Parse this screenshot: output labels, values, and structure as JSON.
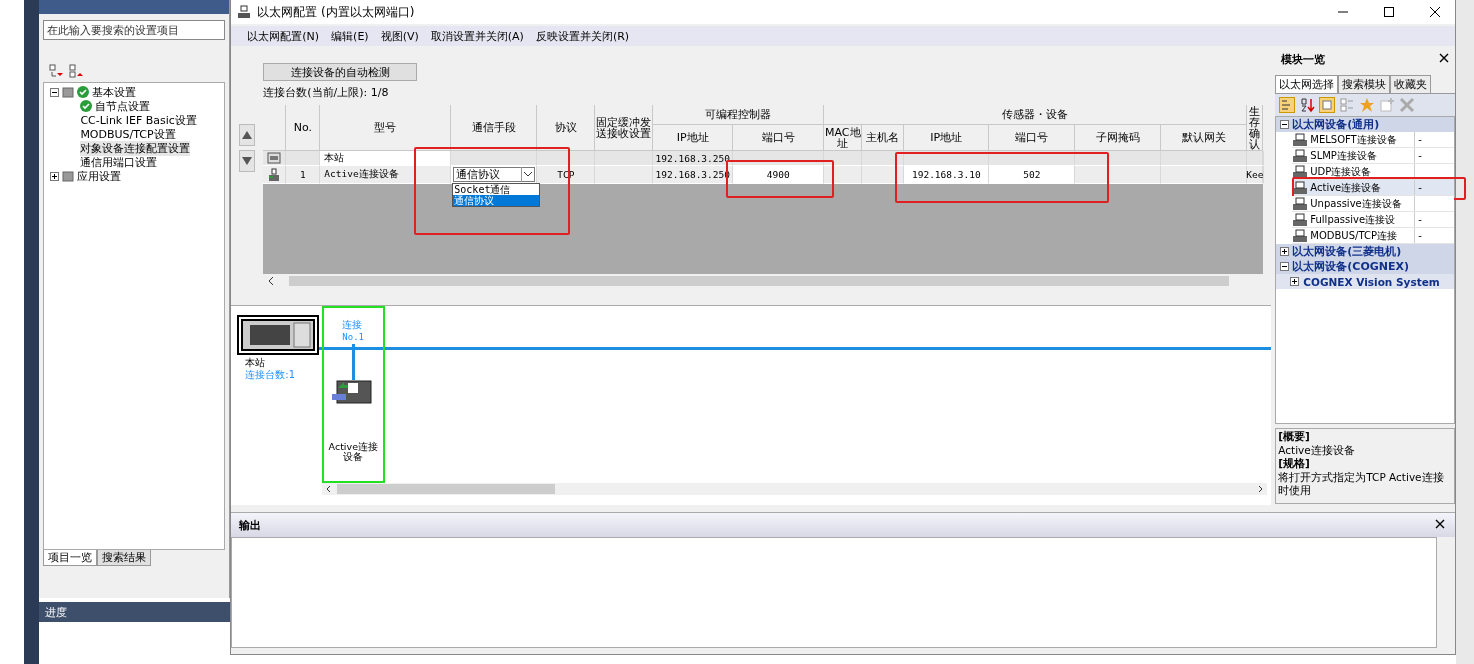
{
  "left_panel": {
    "search": {
      "placeholder": "在此输入要搜索的设置项目"
    },
    "tree": [
      {
        "label": "基本设置",
        "expanded": true,
        "done": true,
        "selected": false,
        "children": [
          {
            "label": "自节点设置",
            "done": true,
            "selected": false
          },
          {
            "label": "CC-Link IEF Basic设置",
            "done": false,
            "selected": false
          },
          {
            "label": "MODBUS/TCP设置",
            "done": false,
            "selected": false
          },
          {
            "label": "对象设备连接配置设置",
            "done": false,
            "selected": true
          },
          {
            "label": "通信用端口设置",
            "done": false,
            "selected": false
          }
        ]
      },
      {
        "label": "应用设置",
        "expanded": false,
        "done": false,
        "selected": false
      }
    ],
    "tabs": [
      {
        "label": "项目一览",
        "selected": true
      },
      {
        "label": "搜索结果",
        "selected": false
      }
    ]
  },
  "progress_bar": {
    "title": "进度"
  },
  "window": {
    "title": "以太网配置 (内置以太网端口)",
    "menu": [
      "以太网配置(N)",
      "编辑(E)",
      "视图(V)",
      "取消设置并关闭(A)",
      "反映设置并关闭(R)"
    ]
  },
  "auto_detect_button": "连接设备的自动检测",
  "connection_count": "连接台数(当前/上限):  1/8",
  "table": {
    "columns": [
      {
        "kind": "single",
        "label": "No."
      },
      {
        "kind": "single",
        "label": "型号"
      },
      {
        "kind": "single",
        "label": "通信手段"
      },
      {
        "kind": "single",
        "label": "协议"
      },
      {
        "kind": "single",
        "label": "固定缓冲发送接收设置"
      },
      {
        "kind": "group",
        "label": "可编程控制器",
        "columns": [
          "IP地址",
          "端口号"
        ]
      },
      {
        "kind": "group",
        "label": "传感器・设备",
        "columns": [
          "MAC地址",
          "主机名",
          "IP地址",
          "端口号",
          "子网掩码",
          "默认网关"
        ]
      },
      {
        "kind": "single",
        "label": "生存确认"
      }
    ],
    "rows": [
      {
        "kind": "station",
        "model": "本站",
        "plc_ip": "192.168.3.250"
      },
      {
        "kind": "device",
        "no": "1",
        "model": "Active连接设备",
        "comm": {
          "value": "通信协议",
          "expanded": true,
          "options": [
            {
              "label": "Socket通信",
              "selected": false
            },
            {
              "label": "通信协议",
              "selected": true
            }
          ]
        },
        "protocol": "TCP",
        "plc_ip": "192.168.3.250",
        "plc_port": "4900",
        "sensor_ip": "192.168.3.10",
        "sensor_port": "502",
        "keepalive": "Kee"
      }
    ],
    "highlight_frames": [
      {
        "kind": "dropdown"
      },
      {
        "kind": "port"
      },
      {
        "kind": "sensor"
      }
    ]
  },
  "diagram": {
    "station": {
      "label": "本站",
      "count": "连接台数:1"
    },
    "connections": [
      {
        "label": "连接",
        "number": "No.1",
        "device": "Active连接设备",
        "selected": true
      }
    ]
  },
  "output_panel": {
    "title": "输出"
  },
  "module_panel": {
    "title": "模块一览",
    "tabs": [
      {
        "label": "以太网选择",
        "selected": true
      },
      {
        "label": "搜索模块",
        "selected": false
      },
      {
        "label": "收藏夹",
        "selected": false
      }
    ],
    "groups": [
      {
        "label": "以太网设备(通用)",
        "expanded": true,
        "items": [
          {
            "kind": "device",
            "label": "MELSOFT连接设备",
            "value": "-",
            "selected": false,
            "highlighted": false
          },
          {
            "kind": "device",
            "label": "SLMP连接设备",
            "value": "-",
            "selected": false,
            "highlighted": false
          },
          {
            "kind": "device",
            "label": "UDP连接设备",
            "selected": false,
            "highlighted": false
          },
          {
            "kind": "device",
            "label": "Active连接设备",
            "value": "-",
            "selected": true,
            "highlighted": true
          },
          {
            "kind": "device",
            "label": "Unpassive连接设备",
            "selected": false,
            "highlighted": false
          },
          {
            "kind": "device",
            "label": "Fullpassive连接设",
            "value": "-",
            "selected": false,
            "highlighted": false
          },
          {
            "kind": "device",
            "label": "MODBUS/TCP连接",
            "value": "-",
            "selected": false,
            "highlighted": false
          }
        ]
      },
      {
        "label": "以太网设备(三菱电机)",
        "expanded": false
      },
      {
        "label": "以太网设备(COGNEX)",
        "expanded": true,
        "items": [
          {
            "kind": "subgroup",
            "label": "COGNEX Vision System",
            "expanded": false
          }
        ]
      }
    ],
    "description": [
      {
        "kind": "heading",
        "text": "[概要]"
      },
      {
        "kind": "body",
        "text": "Active连接设备"
      },
      {
        "kind": "heading",
        "text": "[规格]"
      },
      {
        "kind": "body",
        "text": "将打开方式指定为TCP Active连接时使用"
      }
    ]
  }
}
